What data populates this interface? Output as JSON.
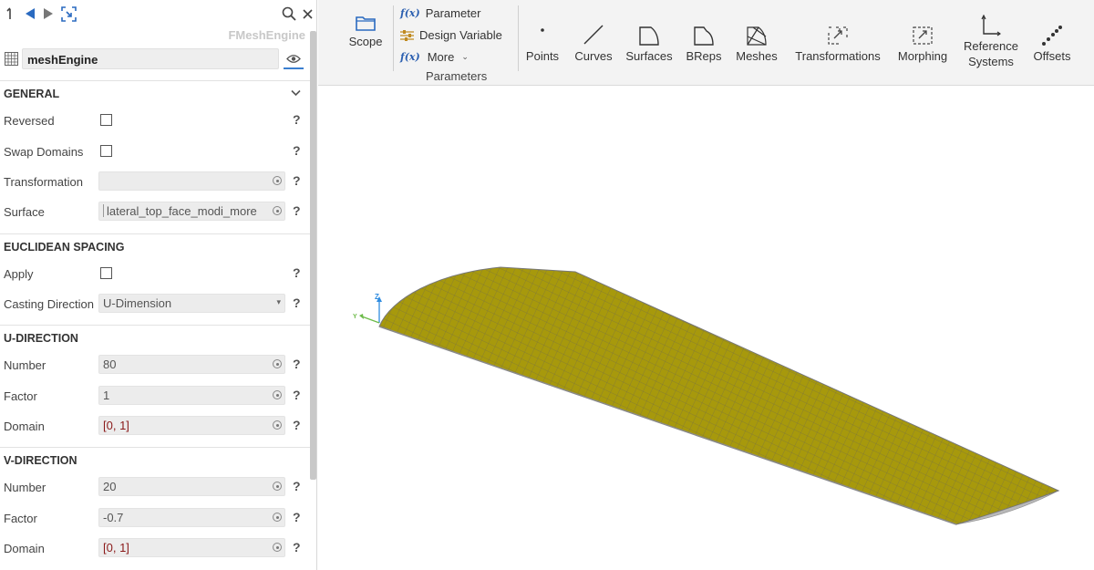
{
  "panel": {
    "title": "FMeshEngine",
    "name": "meshEngine",
    "sections": {
      "general": "GENERAL",
      "euclidean": "EUCLIDEAN SPACING",
      "u_direction": "U-DIRECTION",
      "v_direction": "V-DIRECTION"
    },
    "rows": {
      "reversed": "Reversed",
      "swap_domains": "Swap Domains",
      "transformation": "Transformation",
      "transformation_value": "",
      "surface": "Surface",
      "surface_value": "lateral_top_face_modi_more",
      "apply": "Apply",
      "casting_direction": "Casting Direction",
      "casting_value": "U-Dimension",
      "u_number": "Number",
      "u_number_value": "80",
      "u_factor": "Factor",
      "u_factor_value": "1",
      "u_domain": "Domain",
      "u_domain_value": "[0, 1]",
      "v_number": "Number",
      "v_number_value": "20",
      "v_factor": "Factor",
      "v_factor_value": "-0.7",
      "v_domain": "Domain",
      "v_domain_value": "[0, 1]"
    },
    "help_glyph": "?"
  },
  "ribbon": {
    "scope": "Scope",
    "parameter": "Parameter",
    "design_variable": "Design Variable",
    "more": "More",
    "parameters_group": "Parameters",
    "fx_glyph": "f(x)",
    "points": "Points",
    "curves": "Curves",
    "surfaces": "Surfaces",
    "breps": "BReps",
    "meshes": "Meshes",
    "transformations": "Transformations",
    "morphing": "Morphing",
    "reference_systems_1": "Reference",
    "reference_systems_2": "Systems",
    "offsets": "Offsets"
  },
  "viewport": {
    "axis_z": "Z",
    "axis_y": "Y"
  },
  "colors": {
    "accent": "#3b7fd0",
    "mesh_face": "#a7990c",
    "mesh_line": "#6f6a50",
    "underside": "#b8b8b8"
  }
}
